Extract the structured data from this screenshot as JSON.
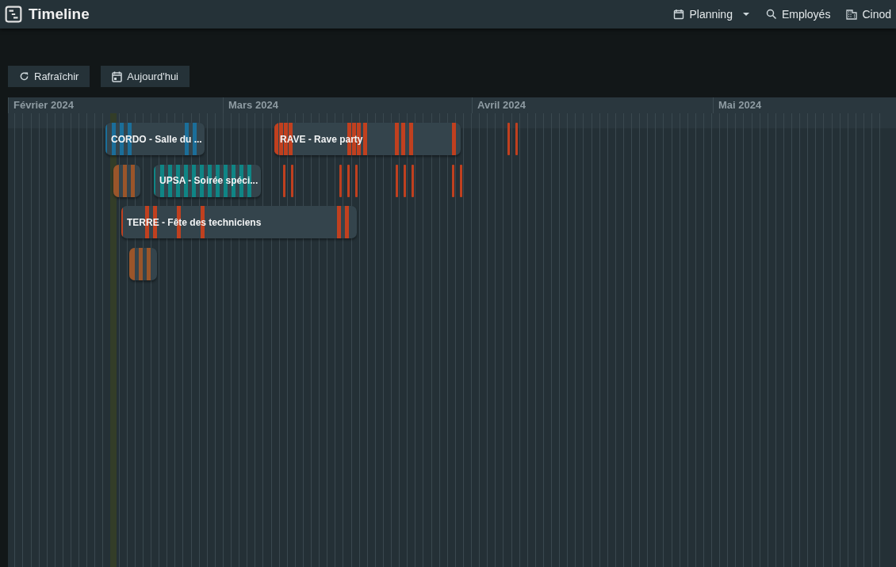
{
  "app_bar": {
    "title": "Timeline",
    "nav": [
      {
        "label": "Planning",
        "kind": "dropdown"
      },
      {
        "label": "Employés",
        "kind": "search"
      },
      {
        "label": "Cinod",
        "kind": "building"
      }
    ]
  },
  "toolbar": [
    {
      "label": "Rafraîchir",
      "kind": "refresh"
    },
    {
      "label": "Aujourd'hui",
      "kind": "calendar"
    }
  ],
  "timeline": {
    "months": [
      "Février 2024",
      "Mars 2024",
      "Avril 2024",
      "Mai 2024"
    ],
    "events": [
      {
        "label": "CORDO - Salle du ...",
        "color": "#1b6e99",
        "kind": "bar"
      },
      {
        "label": "RAVE - Rave party",
        "color": "#c0401f",
        "kind": "bar"
      },
      {
        "color": "#c0401f",
        "kind": "marks"
      },
      {
        "color": "#9a552a",
        "kind": "bar"
      },
      {
        "label": "UPSA - Soirée spéci...",
        "color": "#0f8585",
        "kind": "bar"
      },
      {
        "color": "#c0401f",
        "kind": "marks"
      },
      {
        "label": "TERRE - Fête des techniciens",
        "color": "#c0401f",
        "kind": "bar"
      },
      {
        "color": "#9a552a",
        "kind": "bar"
      }
    ]
  }
}
